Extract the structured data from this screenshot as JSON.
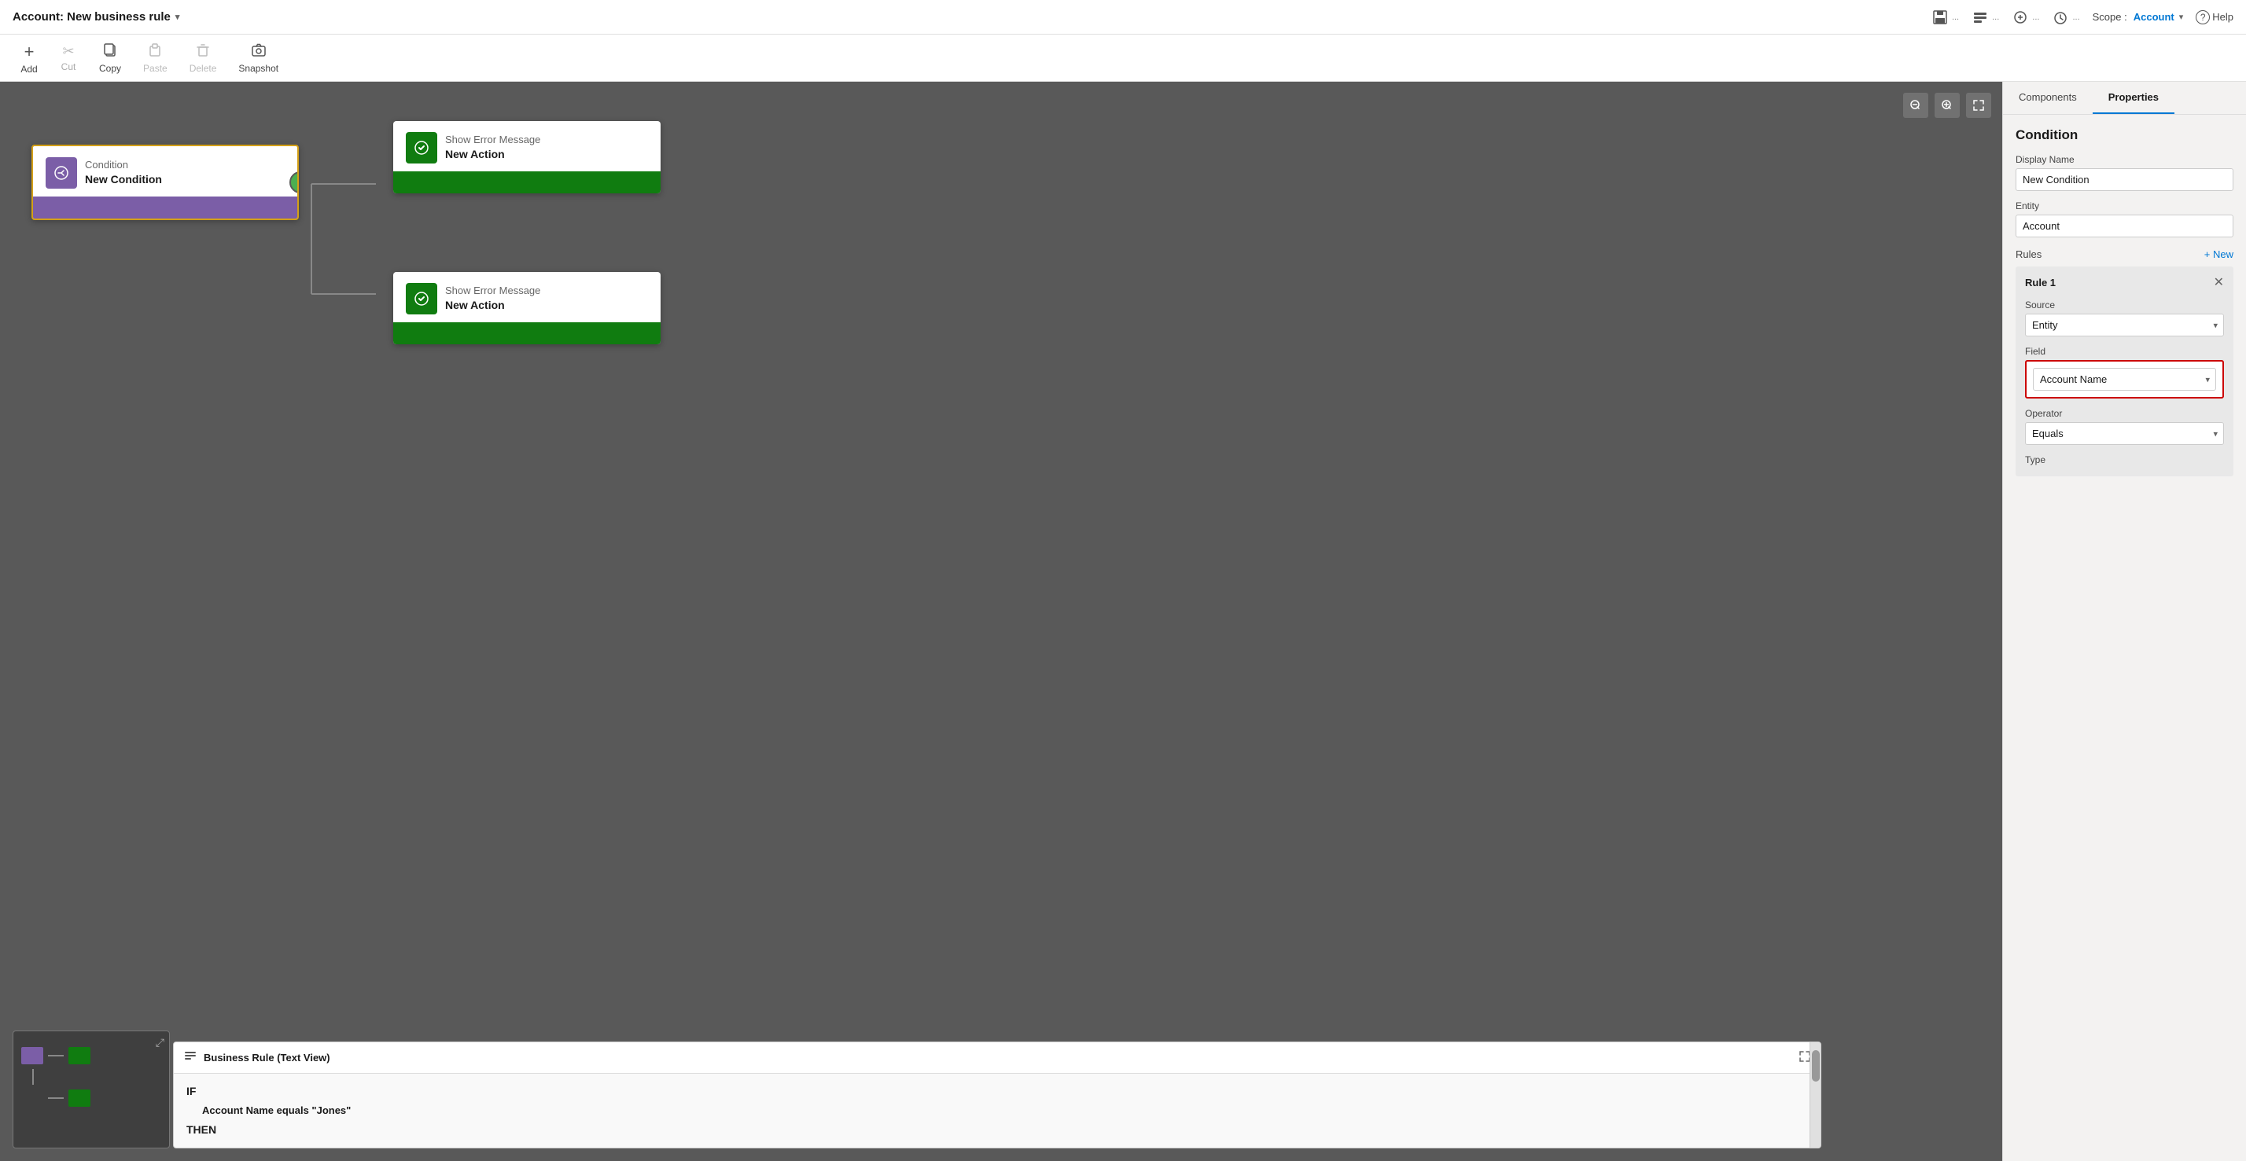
{
  "titleBar": {
    "title": "Account: New business rule",
    "scope_label": "Scope :",
    "scope_value": "Account",
    "help_label": "Help",
    "icons": [
      "save-icon",
      "detail-icon",
      "properties-icon",
      "timer-icon"
    ]
  },
  "toolbar": {
    "items": [
      {
        "id": "add",
        "label": "Add",
        "icon": "+"
      },
      {
        "id": "cut",
        "label": "Cut",
        "icon": "✂"
      },
      {
        "id": "copy",
        "label": "Copy",
        "icon": "⧉"
      },
      {
        "id": "paste",
        "label": "Paste",
        "icon": "📋"
      },
      {
        "id": "delete",
        "label": "Delete",
        "icon": "🗑"
      },
      {
        "id": "snapshot",
        "label": "Snapshot",
        "icon": "📷"
      }
    ]
  },
  "canvas": {
    "zoom_out_title": "Zoom out",
    "zoom_in_title": "Zoom in",
    "fit_title": "Fit to screen"
  },
  "condition_node": {
    "label": "Condition",
    "title": "New Condition"
  },
  "action_node_true": {
    "label": "Show Error Message",
    "title": "New Action"
  },
  "action_node_false": {
    "label": "Show Error Message",
    "title": "New Action"
  },
  "text_view": {
    "title": "Business Rule (Text View)",
    "if_label": "IF",
    "then_label": "THEN",
    "condition_text": "Account Name equals \"Jones\""
  },
  "rightPanel": {
    "tab_components": "Components",
    "tab_properties": "Properties",
    "active_tab": "Properties",
    "section_title": "Condition",
    "display_name_label": "Display Name",
    "display_name_value": "New Condition",
    "entity_label": "Entity",
    "entity_value": "Account",
    "rules_label": "Rules",
    "rules_new_btn": "+ New",
    "rule1": {
      "title": "Rule 1",
      "source_label": "Source",
      "source_value": "Entity",
      "field_label": "Field",
      "field_value": "Account Name",
      "operator_label": "Operator",
      "operator_value": "Equals",
      "type_label": "Type"
    }
  }
}
